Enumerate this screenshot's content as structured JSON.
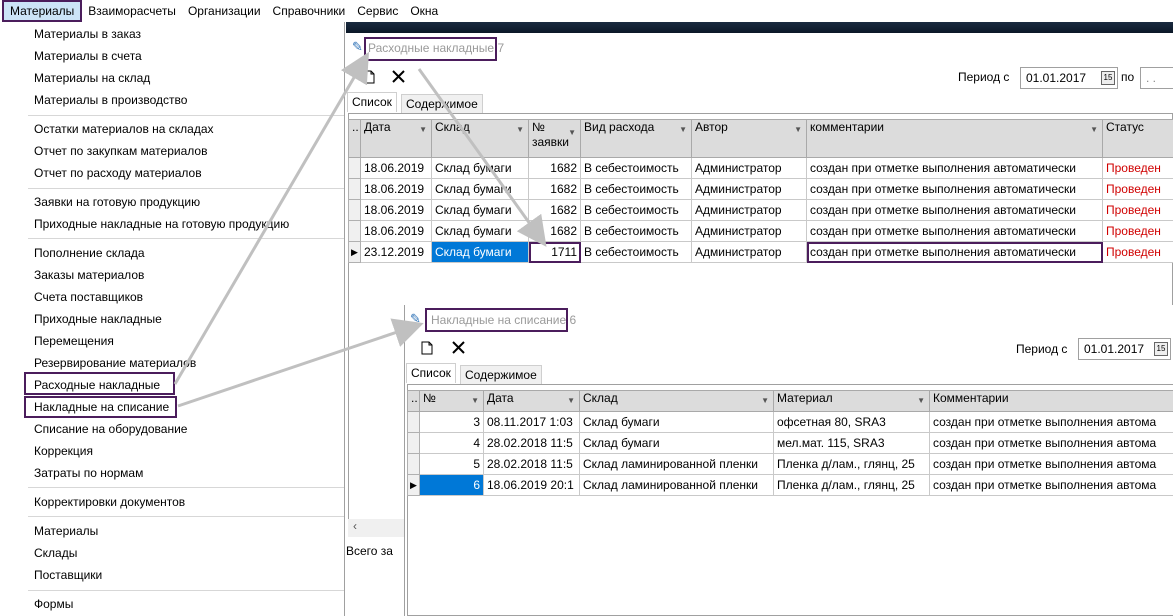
{
  "menubar": {
    "items": [
      "Материалы",
      "Взаиморасчеты",
      "Организации",
      "Справочники",
      "Сервис",
      "Окна"
    ]
  },
  "dropdown": {
    "groups": [
      [
        "Материалы в заказ",
        "Материалы в счета",
        "Материалы на склад",
        "Материалы в производство"
      ],
      [
        "Остатки материалов на складах",
        "Отчет по закупкам материалов",
        "Отчет по расходу материалов"
      ],
      [
        "Заявки на готовую продукцию",
        "Приходные накладные на готовую продукцию"
      ],
      [
        "Пополнение склада",
        "Заказы материалов",
        "Счета поставщиков",
        "Приходные накладные",
        "Перемещения",
        "Резервирование материалов",
        "Расходные накладные",
        "Накладные на списание",
        "Списание на оборудование",
        "Коррекция",
        "Затраты по нормам"
      ],
      [
        "Корректировки документов"
      ],
      [
        "Материалы",
        "Склады",
        "Поставщики"
      ],
      [
        "Формы"
      ]
    ]
  },
  "window1": {
    "title": "Расходные накладные",
    "title_suffix": "7",
    "period_label": "Период с",
    "period_from": "01.01.2017",
    "period_to_label": "по",
    "period_to": ". .",
    "tabs": [
      "Список",
      "Содержимое"
    ],
    "columns": [
      "Дата",
      "Склад",
      "№ заявки",
      "Вид расхода",
      "Автор",
      "комментарии",
      "Статус"
    ],
    "rows": [
      [
        "18.06.2019",
        "Склад бумаги",
        "1682",
        "В себестоимость",
        "Администратор",
        "создан при отметке выполнения автоматически",
        "Проведен"
      ],
      [
        "18.06.2019",
        "Склад бумаги",
        "1682",
        "В себестоимость",
        "Администратор",
        "создан при отметке выполнения автоматически",
        "Проведен"
      ],
      [
        "18.06.2019",
        "Склад бумаги",
        "1682",
        "В себестоимость",
        "Администратор",
        "создан при отметке выполнения автоматически",
        "Проведен"
      ],
      [
        "18.06.2019",
        "Склад бумаги",
        "1682",
        "В себестоимость",
        "Администратор",
        "создан при отметке выполнения автоматически",
        "Проведен"
      ],
      [
        "23.12.2019",
        "Склад бумаги",
        "1711",
        "В себестоимость",
        "Администратор",
        "создан при отметке выполнения автоматически",
        "Проведен"
      ]
    ],
    "status_text": "Всего за"
  },
  "window2": {
    "title": "Накладные на списание",
    "title_suffix": "6",
    "period_label": "Период с",
    "period_from": "01.01.2017",
    "tabs": [
      "Список",
      "Содержимое"
    ],
    "columns": [
      "№",
      "Дата",
      "Склад",
      "Материал",
      "Комментарии"
    ],
    "rows": [
      [
        "3",
        "08.11.2017 1:03",
        "Склад бумаги",
        "офсетная 80, SRA3",
        "создан при отметке выполнения автома"
      ],
      [
        "4",
        "28.02.2018 11:5",
        "Склад бумаги",
        "мел.мат. 115, SRA3",
        "создан при отметке выполнения автома"
      ],
      [
        "5",
        "28.02.2018 11:5",
        "Склад ламинированной пленки",
        "Пленка д/лам., глянц, 25",
        "создан при отметке выполнения автома"
      ],
      [
        "6",
        "18.06.2019 20:1",
        "Склад ламинированной пленки",
        "Пленка д/лам., глянц, 25",
        "создан при отметке выполнения автома"
      ]
    ]
  },
  "colors": {
    "highlight_border": "#4b1d5c",
    "selection": "#0078d7",
    "status_red": "#d00000",
    "arrow": "#c0c0c0"
  }
}
